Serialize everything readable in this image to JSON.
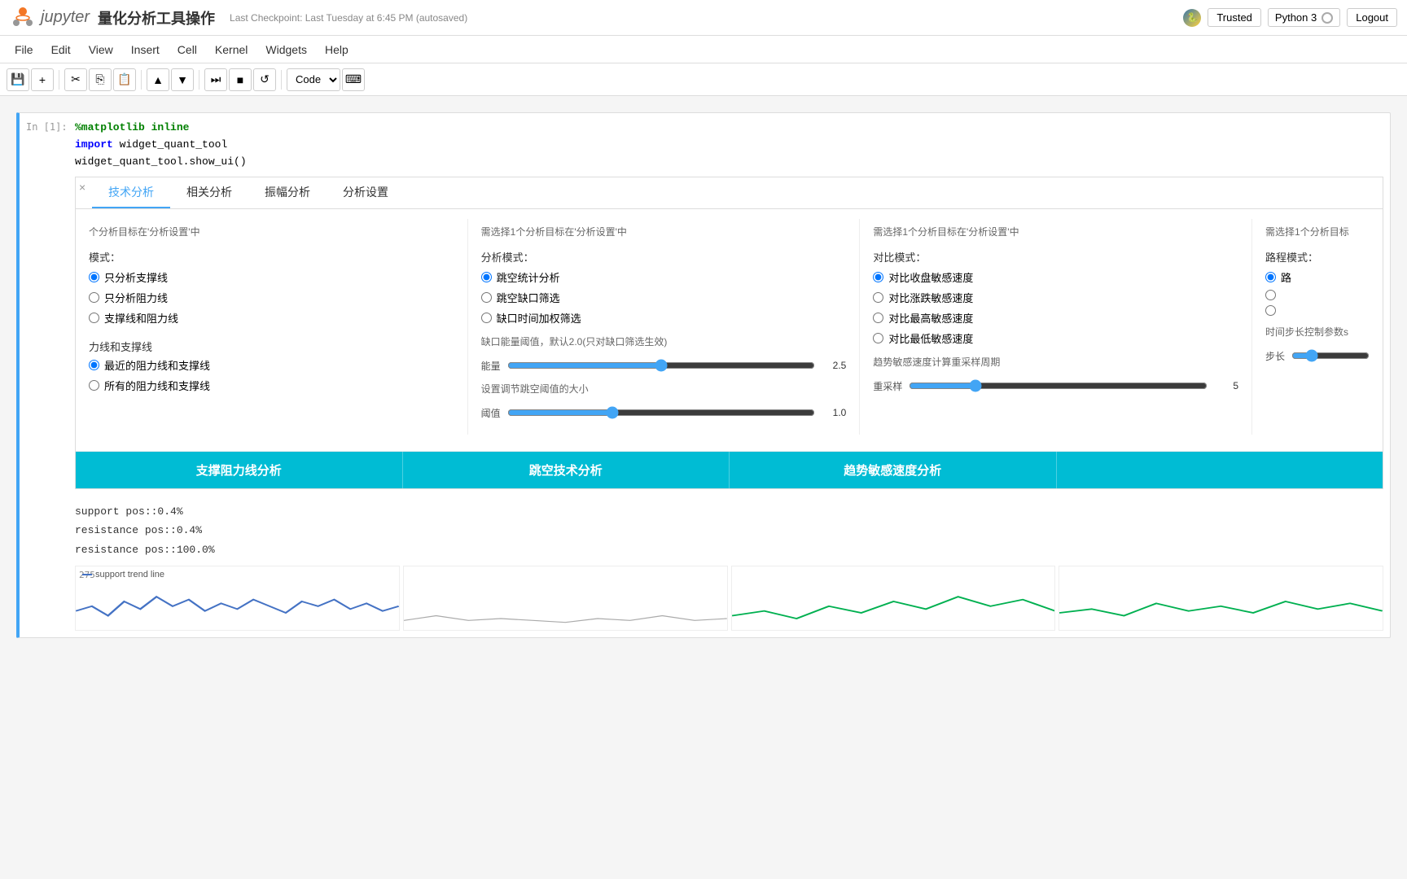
{
  "topbar": {
    "logo_text": "jupyter",
    "notebook_title": "量化分析工具操作",
    "checkpoint": "Last Checkpoint: Last Tuesday at 6:45 PM (autosaved)",
    "trusted_label": "Trusted",
    "kernel_label": "Python 3",
    "logout_label": "Logout"
  },
  "menubar": {
    "items": [
      "File",
      "Edit",
      "View",
      "Insert",
      "Cell",
      "Kernel",
      "Widgets",
      "Help"
    ]
  },
  "toolbar": {
    "cell_type": "Code"
  },
  "cell": {
    "label": "In [1]:",
    "lines": [
      "%matplotlib inline",
      "import widget_quant_tool",
      "widget_quant_tool.show_ui()"
    ]
  },
  "widget": {
    "tabs": [
      "技术分析",
      "相关分析",
      "振幅分析",
      "分析设置"
    ],
    "active_tab": 0,
    "close_btn": "×",
    "sections": {
      "section1": {
        "desc": "个分析目标在'分析设置'中",
        "mode_label": "模式：",
        "mode_selected": "只分析支撑线",
        "modes": [
          "只分析支撑线",
          "只分析阻力线",
          "支撑线和阻力线"
        ],
        "line_label": "力线和支撑线",
        "line_selected": "最近的阻力线和支撑线",
        "lines": [
          "最近的阻力线和支撑线",
          "所有的阻力线和支撑线"
        ]
      },
      "section2": {
        "desc": "需选择1个分析目标在'分析设置'中",
        "analysis_mode_label": "分析模式：",
        "analysis_mode_selected": "跳空统计分析",
        "analysis_modes": [
          "跳空统计分析",
          "跳空缺口筛选",
          "缺口时间加权筛选"
        ],
        "threshold_desc": "缺口能量阈值，默认2.0(只对缺口筛选生效)",
        "energy_label": "能量",
        "energy_value": "2.5",
        "energy_min": 0,
        "energy_max": 5,
        "energy_current": 2.5,
        "adjust_desc": "设置调节跳空阈值的大小",
        "threshold_label": "阈值",
        "threshold_value": "1.0",
        "threshold_min": 0,
        "threshold_max": 3,
        "threshold_current": 1.0
      },
      "section3": {
        "desc": "需选择1个分析目标在'分析设置'中",
        "contrast_label": "对比模式：",
        "contrast_selected": "对比收盘敏感速度",
        "contrasts": [
          "对比收盘敏感速度",
          "对比涨跌敏感速度",
          "对比最高敏感速度",
          "对比最低敏感速度"
        ],
        "resample_desc": "趋势敏感速度计算重采样周期",
        "resample_label": "重采样",
        "resample_value": "5",
        "resample_min": 1,
        "resample_max": 20,
        "resample_current": 5
      },
      "section4": {
        "desc": "需选择1个分析目标",
        "route_label": "路程模式：",
        "route_selected": "路",
        "step_desc": "时间步长控制参数s",
        "step_label": "步长",
        "step_value": ""
      }
    },
    "buttons": [
      "支撑阻力线分析",
      "跳空技术分析",
      "趋势敏感速度分析",
      ""
    ]
  },
  "output": {
    "lines": [
      "support pos::0.4%",
      "resistance pos::0.4%",
      "resistance pos::100.0%"
    ]
  },
  "chart": {
    "y_label": "275",
    "legend": "support trend line"
  }
}
